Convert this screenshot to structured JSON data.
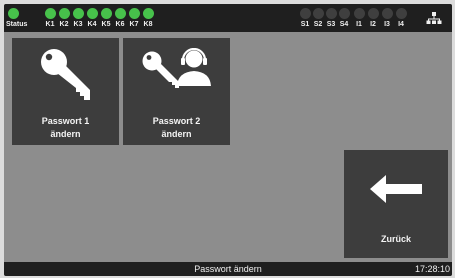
{
  "status_bar": {
    "status_label": "Status",
    "k_labels": [
      "K1",
      "K2",
      "K3",
      "K4",
      "K5",
      "K6",
      "K7",
      "K8"
    ],
    "s_labels": [
      "S1",
      "S2",
      "S3",
      "S4",
      "I1",
      "I2",
      "I3",
      "I4"
    ],
    "colors": {
      "on": "#47c14b",
      "off": "#3f3f3f"
    }
  },
  "tiles": {
    "password1": {
      "line1": "Passwort 1",
      "line2": "ändern",
      "icon": "key-icon"
    },
    "password2": {
      "line1": "Passwort 2",
      "line2": "ändern",
      "icon": "key-headset-user-icon"
    },
    "back": {
      "label": "Zurück",
      "icon": "arrow-left-icon"
    }
  },
  "footer": {
    "title": "Passwort ändern",
    "time": "17:28:10"
  }
}
